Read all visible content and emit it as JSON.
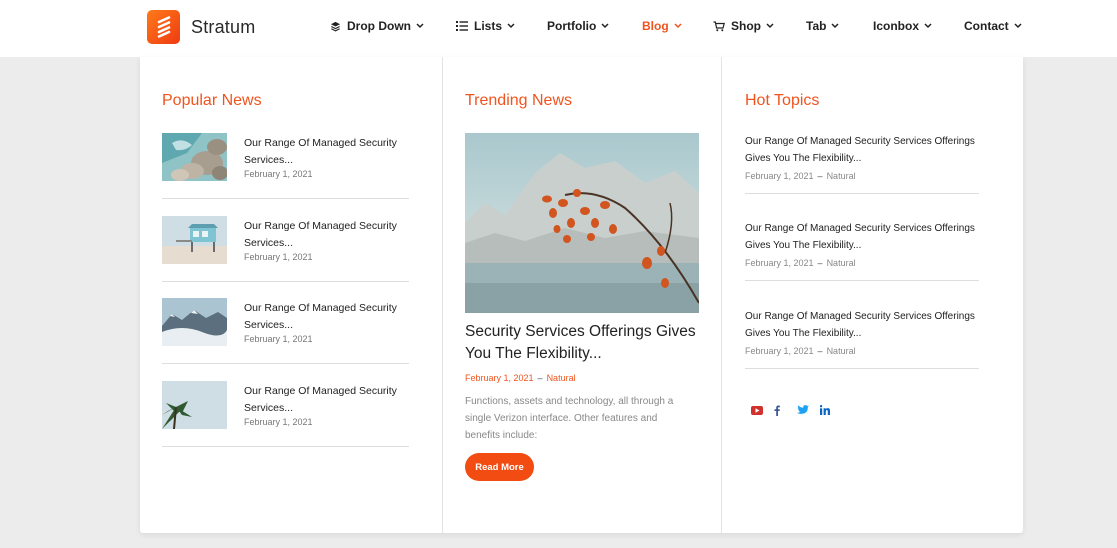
{
  "brand": {
    "name": "Stratum",
    "accent": "#f0541e"
  },
  "nav": {
    "items": [
      {
        "label": "Drop Down",
        "icon": "layers-icon"
      },
      {
        "label": "Lists",
        "icon": "list-icon"
      },
      {
        "label": "Portfolio"
      },
      {
        "label": "Blog",
        "active": true
      },
      {
        "label": "Shop",
        "icon": "cart-icon"
      },
      {
        "label": "Tab"
      },
      {
        "label": "Iconbox"
      },
      {
        "label": "Contact"
      }
    ]
  },
  "popular": {
    "title": "Popular News",
    "items": [
      {
        "title": "Our Range Of Managed Security Services...",
        "date": "February 1, 2021",
        "thumb": "rocky-shore-image"
      },
      {
        "title": "Our Range Of Managed Security Services...",
        "date": "February 1, 2021",
        "thumb": "lifeguard-hut-image"
      },
      {
        "title": "Our Range Of Managed Security Services...",
        "date": "February 1, 2021",
        "thumb": "snowy-mountains-image"
      },
      {
        "title": "Our Range Of Managed Security Services...",
        "date": "February 1, 2021",
        "thumb": "palm-tree-image"
      }
    ]
  },
  "trending": {
    "title": "Trending News",
    "post_title": "Security Services Offerings Gives You The Flexibility...",
    "date": "February 1, 2021",
    "category": "Natural",
    "excerpt": "Functions, assets and technology, all through a single Verizon interface. Other features and benefits include:",
    "button": "Read More",
    "image": "autumn-branch-lake-image"
  },
  "hot": {
    "title": "Hot Topics",
    "items": [
      {
        "title": "Our Range Of Managed Security Services Offerings Gives You The Flexibility...",
        "date": "February 1, 2021",
        "category": "Natural"
      },
      {
        "title": "Our Range Of Managed Security Services Offerings Gives You The Flexibility...",
        "date": "February 1, 2021",
        "category": "Natural"
      },
      {
        "title": "Our Range Of Managed Security Services Offerings Gives You The Flexibility...",
        "date": "February 1, 2021",
        "category": "Natural"
      }
    ]
  },
  "social": {
    "icons": [
      "youtube-icon",
      "facebook-icon",
      "twitter-icon",
      "linkedin-icon"
    ],
    "colors": {
      "youtube": "#d0312d",
      "facebook": "#3b5998",
      "twitter": "#1da1f2",
      "linkedin": "#0a66c2"
    }
  }
}
